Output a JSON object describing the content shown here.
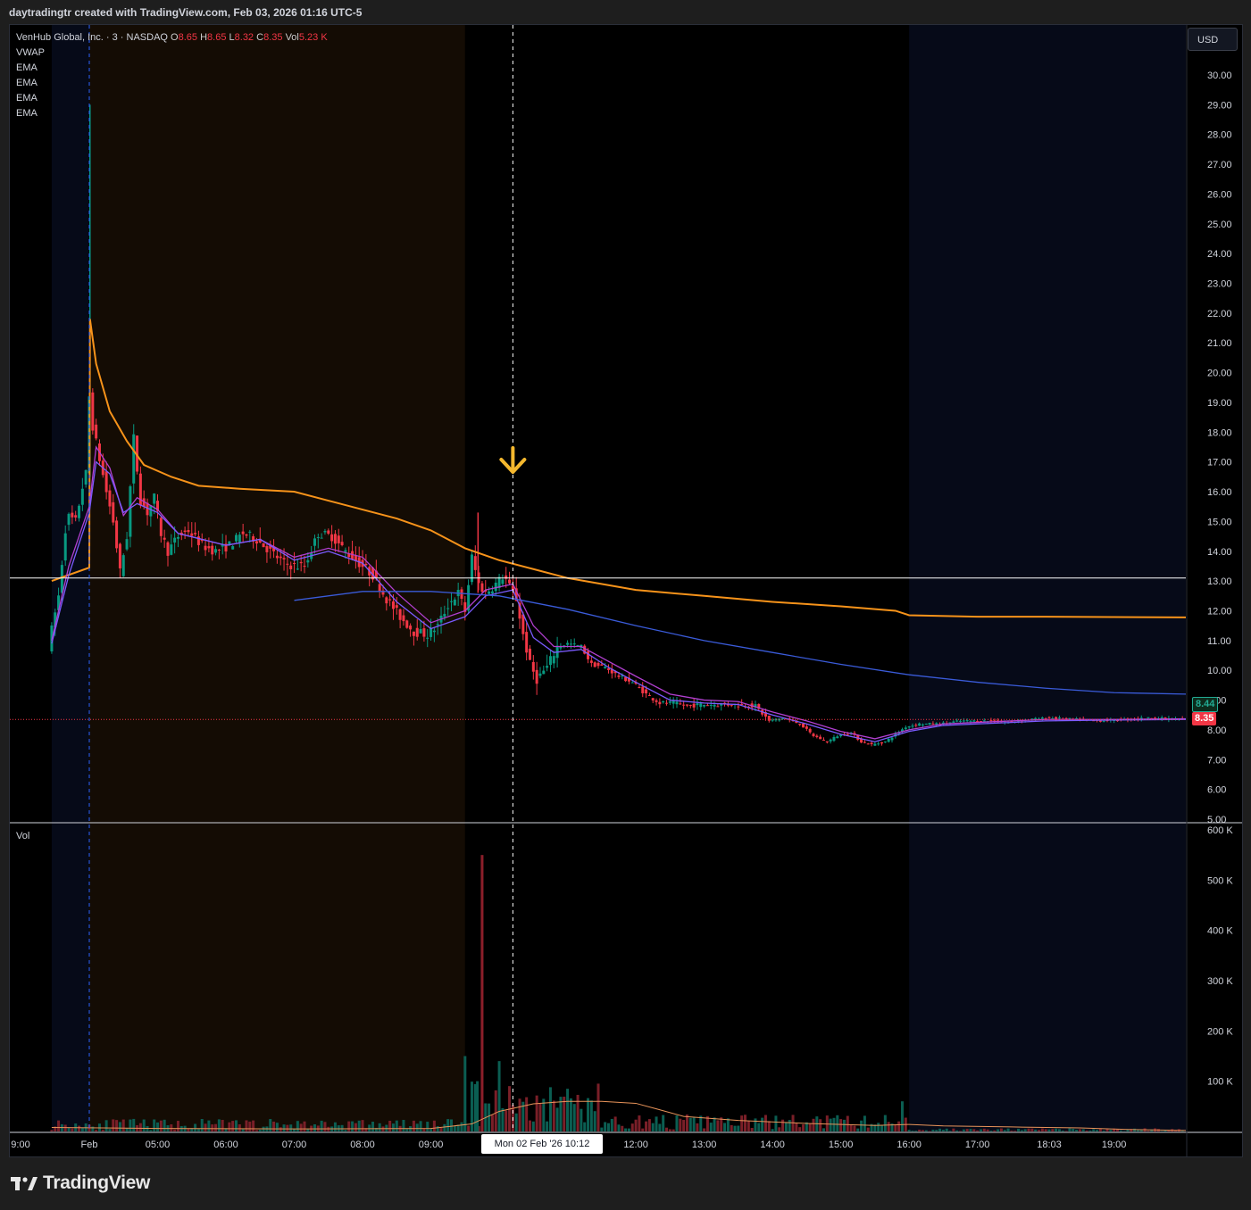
{
  "caption": "daytradingtr created with TradingView.com, Feb 03, 2026 01:16 UTC-5",
  "legend": {
    "symbol": "VenHub Global, Inc. · 3 · NASDAQ",
    "o_label": "O",
    "o_value": "8.65",
    "h_label": "H",
    "h_value": "8.65",
    "l_label": "L",
    "l_value": "8.32",
    "c_label": "C",
    "c_value": "8.35",
    "vol_label": "Vol",
    "vol_value": "5.23 K",
    "indicators": [
      "VWAP",
      "EMA",
      "EMA",
      "EMA",
      "EMA"
    ]
  },
  "currency": "USD",
  "volume_pane_label": "Vol",
  "crosshair_time_label": "Mon 02 Feb '26   10:12",
  "last_price_tags": {
    "upper": "8.44",
    "current": "8.35"
  },
  "brand": "TradingView",
  "colors": {
    "up": "#089981",
    "down": "#f23645",
    "vwap": "#f7931a",
    "ema_purple": "#b13fd0",
    "ema_violet": "#7b5bff",
    "ema_blue": "#3a5bd9",
    "arrow": "#f5b82e",
    "premarket_bg": "#140c04",
    "afterhours_bg": "#060a18"
  },
  "chart_data": {
    "type": "candlestick",
    "title": "VenHub Global, Inc. · 3 · NASDAQ",
    "interval_minutes": 3,
    "y_axis": {
      "ticks": [
        "30.00",
        "29.00",
        "28.00",
        "27.00",
        "26.00",
        "25.00",
        "24.00",
        "23.00",
        "22.00",
        "21.00",
        "20.00",
        "19.00",
        "18.00",
        "17.00",
        "16.00",
        "15.00",
        "14.00",
        "13.00",
        "12.00",
        "11.00",
        "10.00",
        "9.00",
        "8.00",
        "7.00",
        "6.00",
        "5.00"
      ],
      "ylim": [
        5.0,
        30.6
      ]
    },
    "volume_axis": {
      "ticks": [
        "600 K",
        "500 K",
        "400 K",
        "300 K",
        "200 K",
        "100 K"
      ],
      "ylim": [
        0,
        600000
      ]
    },
    "x_axis": {
      "tick_labels": [
        "9:00",
        "Feb",
        "05:00",
        "06:00",
        "07:00",
        "08:00",
        "09:00",
        "11:00",
        "12:00",
        "13:00",
        "14:00",
        "15:00",
        "16:00",
        "17:00",
        "18:03",
        "19:00"
      ],
      "time_range_hours": [
        4.0,
        20.05
      ]
    },
    "sessions": [
      {
        "name": "previous-day",
        "start": 3.45,
        "end": 4.0
      },
      {
        "name": "pre-market",
        "start": 4.0,
        "end": 9.5
      },
      {
        "name": "regular",
        "start": 9.5,
        "end": 16.0
      },
      {
        "name": "after-hours",
        "start": 16.0,
        "end": 20.05
      }
    ],
    "horizontal_lines": [
      {
        "price": 13.1,
        "color": "#ffffff"
      },
      {
        "price": 8.35,
        "color": "#f23645",
        "style": "dotted"
      }
    ],
    "crosshair_time": 10.2,
    "annotation": {
      "type": "arrow-down",
      "time": 10.2,
      "price": 16.9
    },
    "price_path": [
      [
        3.45,
        10.8
      ],
      [
        3.6,
        12.5
      ],
      [
        3.72,
        15.2
      ],
      [
        3.85,
        15.0
      ],
      [
        3.97,
        16.4
      ],
      [
        4.0,
        16.6
      ],
      [
        4.02,
        21.3
      ],
      [
        4.05,
        19.2
      ],
      [
        4.1,
        18.2
      ],
      [
        4.2,
        17.1
      ],
      [
        4.3,
        16.0
      ],
      [
        4.4,
        15.0
      ],
      [
        4.5,
        13.3
      ],
      [
        4.6,
        14.5
      ],
      [
        4.7,
        17.8
      ],
      [
        4.8,
        15.7
      ],
      [
        4.9,
        15.3
      ],
      [
        5.0,
        15.8
      ],
      [
        5.1,
        14.6
      ],
      [
        5.2,
        14.0
      ],
      [
        5.35,
        14.5
      ],
      [
        5.5,
        14.7
      ],
      [
        5.7,
        14.2
      ],
      [
        5.9,
        14.0
      ],
      [
        6.1,
        14.2
      ],
      [
        6.3,
        14.6
      ],
      [
        6.5,
        14.4
      ],
      [
        6.7,
        14.0
      ],
      [
        6.9,
        13.6
      ],
      [
        7.05,
        13.5
      ],
      [
        7.2,
        13.5
      ],
      [
        7.4,
        14.6
      ],
      [
        7.6,
        14.5
      ],
      [
        7.8,
        14.0
      ],
      [
        8.0,
        13.6
      ],
      [
        8.2,
        13.2
      ],
      [
        8.4,
        12.4
      ],
      [
        8.6,
        11.8
      ],
      [
        8.8,
        11.3
      ],
      [
        9.0,
        11.2
      ],
      [
        9.15,
        11.5
      ],
      [
        9.3,
        12.2
      ],
      [
        9.45,
        12.6
      ],
      [
        9.55,
        12.0
      ],
      [
        9.65,
        13.8
      ],
      [
        9.75,
        12.9
      ],
      [
        9.85,
        12.6
      ],
      [
        10.0,
        12.9
      ],
      [
        10.12,
        13.2
      ],
      [
        10.2,
        12.8
      ],
      [
        10.3,
        12.4
      ],
      [
        10.4,
        11.2
      ],
      [
        10.5,
        10.2
      ],
      [
        10.6,
        9.7
      ],
      [
        10.75,
        10.1
      ],
      [
        10.9,
        10.8
      ],
      [
        11.05,
        10.9
      ],
      [
        11.25,
        10.8
      ],
      [
        11.4,
        10.2
      ],
      [
        11.6,
        10.1
      ],
      [
        11.8,
        9.8
      ],
      [
        12.0,
        9.6
      ],
      [
        12.2,
        9.2
      ],
      [
        12.4,
        8.9
      ],
      [
        12.6,
        8.9
      ],
      [
        12.8,
        8.8
      ],
      [
        13.0,
        8.85
      ],
      [
        13.25,
        8.85
      ],
      [
        13.5,
        8.85
      ],
      [
        13.8,
        8.8
      ],
      [
        14.0,
        8.3
      ],
      [
        14.2,
        8.4
      ],
      [
        14.45,
        8.2
      ],
      [
        14.65,
        7.8
      ],
      [
        14.85,
        7.6
      ],
      [
        15.0,
        7.8
      ],
      [
        15.2,
        7.9
      ],
      [
        15.35,
        7.6
      ],
      [
        15.5,
        7.5
      ],
      [
        15.7,
        7.6
      ],
      [
        16.0,
        8.1
      ],
      [
        16.2,
        8.2
      ],
      [
        16.5,
        8.2
      ],
      [
        16.8,
        8.3
      ],
      [
        17.0,
        8.3
      ],
      [
        17.2,
        8.3
      ],
      [
        17.5,
        8.25
      ],
      [
        17.8,
        8.35
      ],
      [
        18.1,
        8.4
      ],
      [
        18.5,
        8.35
      ],
      [
        18.8,
        8.3
      ],
      [
        19.2,
        8.35
      ],
      [
        19.6,
        8.4
      ],
      [
        20.05,
        8.35
      ]
    ],
    "series": [
      {
        "name": "VWAP",
        "color": "#f7931a",
        "points": [
          [
            3.45,
            13.0
          ],
          [
            4.0,
            13.45
          ],
          [
            4.01,
            21.8
          ],
          [
            4.1,
            20.3
          ],
          [
            4.3,
            18.7
          ],
          [
            4.55,
            17.7
          ],
          [
            4.8,
            16.9
          ],
          [
            5.2,
            16.5
          ],
          [
            5.6,
            16.2
          ],
          [
            6.2,
            16.1
          ],
          [
            7.0,
            16.0
          ],
          [
            7.5,
            15.7
          ],
          [
            8.0,
            15.4
          ],
          [
            8.5,
            15.1
          ],
          [
            9.0,
            14.7
          ],
          [
            9.5,
            14.1
          ],
          [
            10.0,
            13.7
          ],
          [
            10.5,
            13.4
          ],
          [
            11.0,
            13.1
          ],
          [
            12.0,
            12.7
          ],
          [
            13.0,
            12.5
          ],
          [
            14.0,
            12.3
          ],
          [
            15.0,
            12.15
          ],
          [
            15.8,
            12.0
          ],
          [
            16.0,
            11.85
          ],
          [
            17.0,
            11.8
          ],
          [
            18.0,
            11.8
          ],
          [
            20.05,
            11.78
          ]
        ]
      },
      {
        "name": "EMA",
        "color": "#b13fd0",
        "points": [
          [
            3.45,
            11.0
          ],
          [
            3.7,
            13.5
          ],
          [
            4.0,
            15.5
          ],
          [
            4.1,
            17.5
          ],
          [
            4.3,
            16.8
          ],
          [
            4.5,
            15.2
          ],
          [
            4.7,
            15.8
          ],
          [
            5.0,
            15.4
          ],
          [
            5.3,
            14.6
          ],
          [
            6.0,
            14.2
          ],
          [
            6.5,
            14.4
          ],
          [
            7.0,
            13.8
          ],
          [
            7.5,
            14.1
          ],
          [
            8.0,
            13.8
          ],
          [
            8.5,
            12.6
          ],
          [
            9.0,
            11.6
          ],
          [
            9.5,
            12.0
          ],
          [
            9.8,
            12.7
          ],
          [
            10.2,
            12.9
          ],
          [
            10.5,
            11.5
          ],
          [
            10.8,
            10.8
          ],
          [
            11.2,
            10.8
          ],
          [
            11.6,
            10.3
          ],
          [
            12.0,
            9.8
          ],
          [
            12.5,
            9.2
          ],
          [
            13.0,
            9.0
          ],
          [
            13.5,
            8.95
          ],
          [
            14.0,
            8.6
          ],
          [
            14.5,
            8.3
          ],
          [
            15.0,
            7.95
          ],
          [
            15.5,
            7.7
          ],
          [
            16.0,
            8.0
          ],
          [
            16.5,
            8.2
          ],
          [
            17.0,
            8.25
          ],
          [
            18.0,
            8.35
          ],
          [
            19.0,
            8.35
          ],
          [
            20.05,
            8.37
          ]
        ]
      },
      {
        "name": "EMA",
        "color": "#7b5bff",
        "points": [
          [
            3.45,
            10.9
          ],
          [
            3.7,
            13.2
          ],
          [
            4.0,
            15.3
          ],
          [
            4.1,
            17.0
          ],
          [
            4.3,
            16.6
          ],
          [
            4.5,
            15.3
          ],
          [
            4.7,
            15.6
          ],
          [
            5.0,
            15.3
          ],
          [
            5.3,
            14.6
          ],
          [
            6.0,
            14.2
          ],
          [
            6.5,
            14.4
          ],
          [
            7.0,
            13.7
          ],
          [
            7.5,
            14.0
          ],
          [
            8.0,
            13.6
          ],
          [
            8.5,
            12.3
          ],
          [
            9.0,
            11.4
          ],
          [
            9.5,
            11.8
          ],
          [
            9.8,
            12.5
          ],
          [
            10.2,
            12.7
          ],
          [
            10.5,
            11.1
          ],
          [
            10.8,
            10.6
          ],
          [
            11.2,
            10.7
          ],
          [
            11.6,
            10.1
          ],
          [
            12.0,
            9.6
          ],
          [
            12.5,
            9.0
          ],
          [
            13.0,
            8.9
          ],
          [
            13.5,
            8.85
          ],
          [
            14.0,
            8.5
          ],
          [
            14.5,
            8.2
          ],
          [
            15.0,
            7.85
          ],
          [
            15.5,
            7.6
          ],
          [
            16.0,
            7.95
          ],
          [
            16.5,
            8.15
          ],
          [
            17.0,
            8.2
          ],
          [
            18.0,
            8.3
          ],
          [
            19.0,
            8.33
          ],
          [
            20.05,
            8.35
          ]
        ]
      },
      {
        "name": "EMA",
        "color": "#3a5bd9",
        "points": [
          [
            7.0,
            12.35
          ],
          [
            8.0,
            12.65
          ],
          [
            9.0,
            12.65
          ],
          [
            10.0,
            12.5
          ],
          [
            11.0,
            12.05
          ],
          [
            12.0,
            11.5
          ],
          [
            13.0,
            11.0
          ],
          [
            14.0,
            10.6
          ],
          [
            15.0,
            10.2
          ],
          [
            16.0,
            9.85
          ],
          [
            17.0,
            9.6
          ],
          [
            18.0,
            9.4
          ],
          [
            19.0,
            9.25
          ],
          [
            20.05,
            9.2
          ]
        ]
      }
    ],
    "volume_spikes": [
      {
        "time": 9.75,
        "volume": 550000
      },
      {
        "time": 9.68,
        "volume": 100000
      },
      {
        "time": 9.5,
        "volume": 150000
      },
      {
        "time": 10.0,
        "volume": 140000
      },
      {
        "time": 11.0,
        "volume": 85000
      },
      {
        "time": 15.9,
        "volume": 60000
      }
    ],
    "volume_ma": [
      [
        3.45,
        8000
      ],
      [
        5.0,
        6000
      ],
      [
        7.0,
        5000
      ],
      [
        9.0,
        6000
      ],
      [
        9.6,
        15000
      ],
      [
        10.0,
        40000
      ],
      [
        10.5,
        55000
      ],
      [
        11.0,
        60000
      ],
      [
        11.5,
        60000
      ],
      [
        12.0,
        56000
      ],
      [
        12.3,
        45000
      ],
      [
        12.7,
        30000
      ],
      [
        13.5,
        22000
      ],
      [
        14.5,
        16000
      ],
      [
        15.5,
        12000
      ],
      [
        16.0,
        14000
      ],
      [
        16.5,
        11000
      ],
      [
        17.5,
        9000
      ],
      [
        18.5,
        7000
      ],
      [
        19.2,
        4000
      ],
      [
        20.05,
        2000
      ]
    ]
  }
}
